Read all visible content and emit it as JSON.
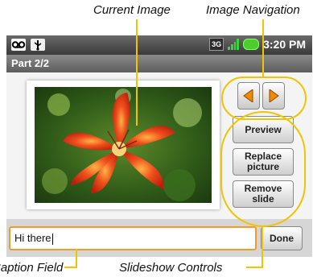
{
  "callouts": {
    "current_image": "Current Image",
    "image_navigation": "Image Navigation",
    "caption_field": "Caption Field",
    "slideshow_controls": "Slideshow Controls"
  },
  "status_bar": {
    "network": "3G",
    "time": "3:20 PM",
    "icons": [
      "voicemail-icon",
      "usb-icon",
      "3g-icon",
      "signal-icon",
      "battery-icon"
    ]
  },
  "title_bar": {
    "title": "Part 2/2"
  },
  "image": {
    "subject": "red lily flower"
  },
  "navigation": {
    "prev_icon": "arrow-left-icon",
    "next_icon": "arrow-right-icon"
  },
  "controls": {
    "preview": "Preview",
    "replace": "Replace\npicture",
    "remove": "Remove\nslide"
  },
  "caption": {
    "value": "Hi there"
  },
  "done_label": "Done",
  "colors": {
    "highlight": "#f2c400",
    "caption_border": "#f39a2c",
    "nav_arrow": "#f08a00"
  }
}
